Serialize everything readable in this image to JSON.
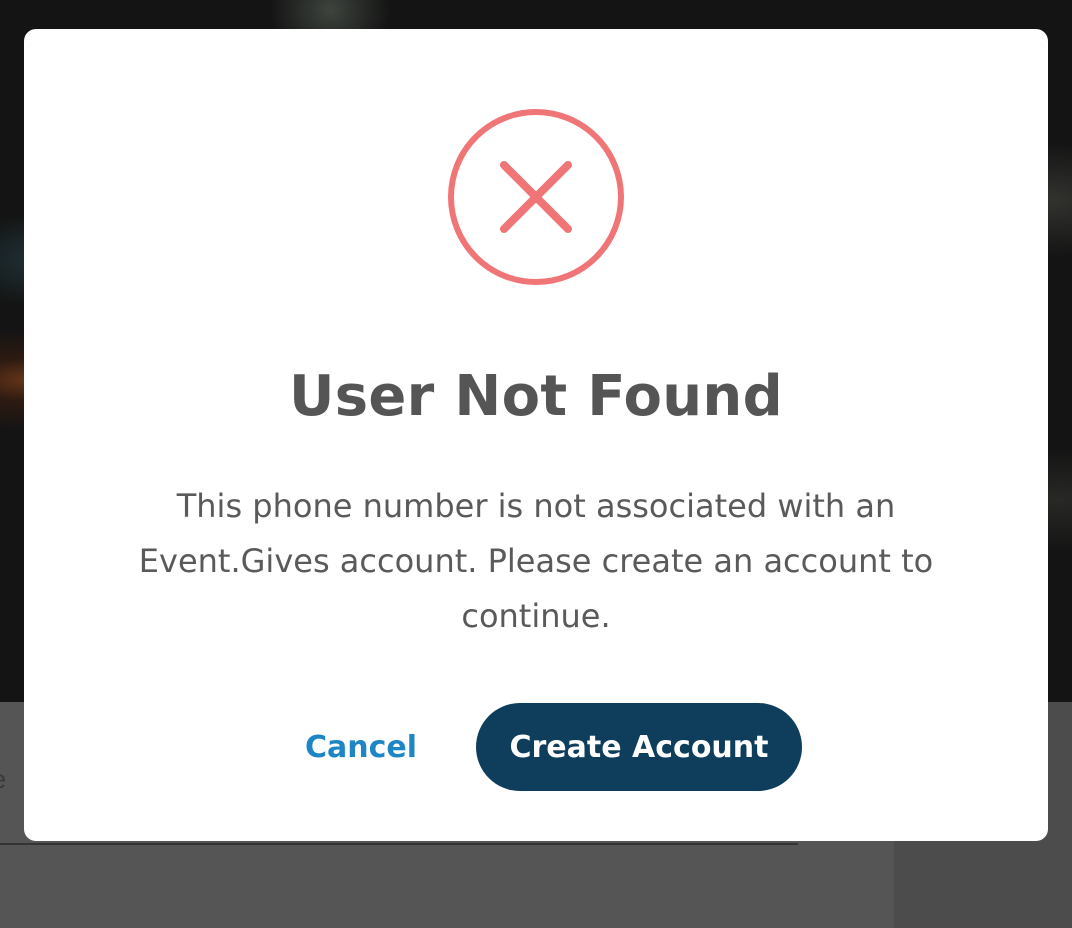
{
  "dialog": {
    "title": "User Not Found",
    "message": "This phone number is not associated with an Event.Gives account. Please create an account to continue.",
    "icon": "error-x-circle-icon",
    "icon_color": "#f07577",
    "cancel_label": "Cancel",
    "create_label": "Create Account",
    "cancel_color": "#1f86c6",
    "primary_color": "#0f3d5c"
  },
  "background": {
    "input_partial_text": "le"
  }
}
